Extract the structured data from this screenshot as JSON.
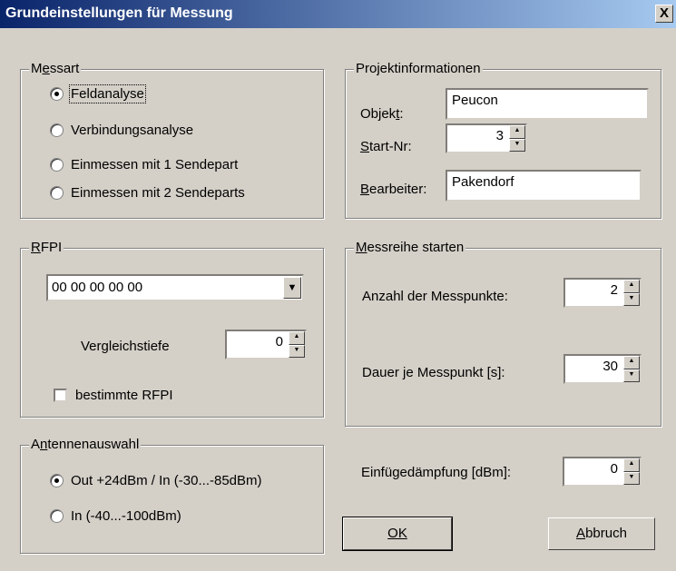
{
  "window": {
    "title": "Grundeinstellungen für Messung",
    "close_label": "X"
  },
  "messart": {
    "legend": "Messart",
    "options": [
      {
        "label": "Feldanalyse",
        "checked": true
      },
      {
        "label": "Verbindungsanalyse",
        "checked": false
      },
      {
        "label": "Einmessen mit 1 Sendepart",
        "checked": false
      },
      {
        "label": "Einmessen mit 2 Sendeparts",
        "checked": false
      }
    ]
  },
  "projekt": {
    "legend": "Projektinformationen",
    "objekt_label": "Objekt:",
    "objekt_value": "Peucon",
    "startnr_label": "Start-Nr:",
    "startnr_value": "3",
    "bearbeiter_label": "Bearbeiter:",
    "bearbeiter_value": "Pakendorf"
  },
  "rfpi": {
    "legend": "RFPI",
    "value": "00 00 00 00 00",
    "vergleichstiefe_label": "Vergleichstiefe",
    "vergleichstiefe_value": "0",
    "bestimmte_label": "bestimmte RFPI",
    "bestimmte_checked": false
  },
  "messreihe": {
    "legend": "Messreihe starten",
    "anzahl_label": "Anzahl der Messpunkte:",
    "anzahl_value": "2",
    "dauer_label": "Dauer je Messpunkt [s]:",
    "dauer_value": "30"
  },
  "antenne": {
    "legend": "Antennenauswahl",
    "options": [
      {
        "label": "Out +24dBm / In (-30...-85dBm)",
        "checked": true
      },
      {
        "label": "In (-40...-100dBm)",
        "checked": false
      }
    ]
  },
  "einfuege": {
    "label": "Einfügedämpfung [dBm]:",
    "value": "0"
  },
  "buttons": {
    "ok": "OK",
    "abbruch": "Abbruch"
  }
}
